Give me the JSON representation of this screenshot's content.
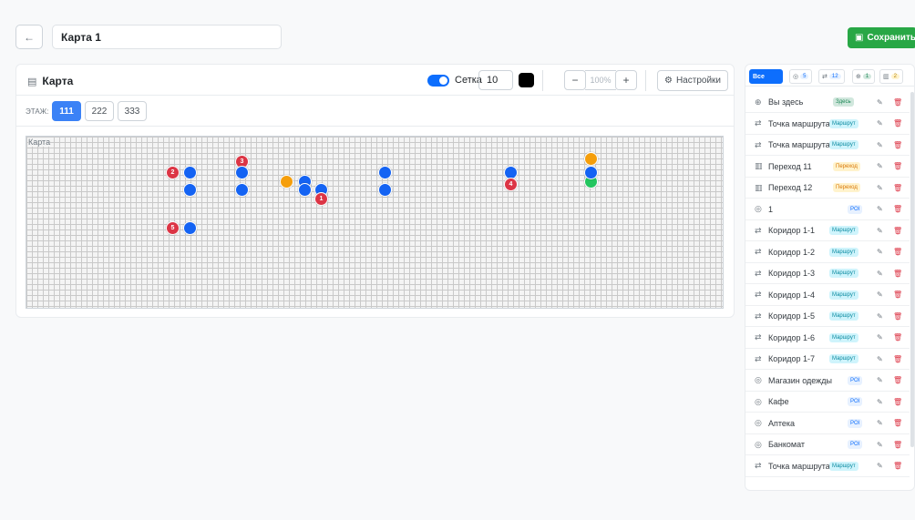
{
  "header": {
    "back_icon": "←",
    "title_value": "Карта 1",
    "save_label": "Сохранить"
  },
  "map_card": {
    "title": "Карта",
    "grid_label": "Сетка",
    "grid_size": "10",
    "zoom_minus": "−",
    "zoom_value": "100%",
    "zoom_plus": "+",
    "settings_label": "Настройки",
    "floor_label": "ЭТАЖ:",
    "floors": [
      "111",
      "222",
      "333"
    ],
    "map_alt": "Карта",
    "markers": [
      {
        "type": "red",
        "label": "2"
      },
      {
        "type": "blue",
        "label": ""
      },
      {
        "type": "blue",
        "label": ""
      },
      {
        "type": "red",
        "label": "3"
      },
      {
        "type": "blue",
        "label": ""
      },
      {
        "type": "blue",
        "label": ""
      },
      {
        "type": "orange",
        "label": ""
      },
      {
        "type": "blue",
        "label": ""
      },
      {
        "type": "blue",
        "label": ""
      },
      {
        "type": "blue",
        "label": ""
      },
      {
        "type": "red",
        "label": "1"
      },
      {
        "type": "blue",
        "label": ""
      },
      {
        "type": "blue",
        "label": ""
      },
      {
        "type": "blue",
        "label": ""
      },
      {
        "type": "red",
        "label": "4"
      },
      {
        "type": "orange",
        "label": ""
      },
      {
        "type": "green",
        "label": ""
      },
      {
        "type": "blue",
        "label": ""
      },
      {
        "type": "red",
        "label": "5"
      },
      {
        "type": "blue",
        "label": ""
      }
    ]
  },
  "panel": {
    "filters": [
      {
        "label": "Все",
        "count": "",
        "active": true
      },
      {
        "label": "◎",
        "count": "5",
        "cls": ""
      },
      {
        "label": "⇄",
        "count": "12",
        "cls": ""
      },
      {
        "label": "⊕",
        "count": "1",
        "cls": "g"
      },
      {
        "label": "▥",
        "count": "2",
        "cls": "o"
      }
    ],
    "items": [
      {
        "icon": "⊕",
        "label": "Вы здесь",
        "badge": "Здесь",
        "kind": "here"
      },
      {
        "icon": "⇄",
        "label": "Точка маршрута",
        "badge": "Маршрут",
        "kind": "route"
      },
      {
        "icon": "⇄",
        "label": "Точка маршрута",
        "badge": "Маршрут",
        "kind": "route"
      },
      {
        "icon": "▥",
        "label": "Переход 11",
        "badge": "Переход",
        "kind": "trans"
      },
      {
        "icon": "▥",
        "label": "Переход 12",
        "badge": "Переход",
        "kind": "trans"
      },
      {
        "icon": "◎",
        "label": "1",
        "badge": "POI",
        "kind": "poi"
      },
      {
        "icon": "⇄",
        "label": "Коридор 1-1",
        "badge": "Маршрут",
        "kind": "route"
      },
      {
        "icon": "⇄",
        "label": "Коридор 1-2",
        "badge": "Маршрут",
        "kind": "route"
      },
      {
        "icon": "⇄",
        "label": "Коридор 1-3",
        "badge": "Маршрут",
        "kind": "route"
      },
      {
        "icon": "⇄",
        "label": "Коридор 1-4",
        "badge": "Маршрут",
        "kind": "route"
      },
      {
        "icon": "⇄",
        "label": "Коридор 1-5",
        "badge": "Маршрут",
        "kind": "route"
      },
      {
        "icon": "⇄",
        "label": "Коридор 1-6",
        "badge": "Маршрут",
        "kind": "route"
      },
      {
        "icon": "⇄",
        "label": "Коридор 1-7",
        "badge": "Маршрут",
        "kind": "route"
      },
      {
        "icon": "◎",
        "label": "Магазин одежды",
        "badge": "POI",
        "kind": "poi"
      },
      {
        "icon": "◎",
        "label": "Кафе",
        "badge": "POI",
        "kind": "poi"
      },
      {
        "icon": "◎",
        "label": "Аптека",
        "badge": "POI",
        "kind": "poi"
      },
      {
        "icon": "◎",
        "label": "Банкомат",
        "badge": "POI",
        "kind": "poi"
      },
      {
        "icon": "⇄",
        "label": "Точка маршрута",
        "badge": "Маршрут",
        "kind": "route"
      }
    ],
    "edit_icon": "✎",
    "delete_icon": "🗑"
  },
  "colors": {
    "accent": "#0d6efd",
    "save": "#28a745",
    "danger": "#dc3545",
    "marker_blue": "#1463f3",
    "marker_orange": "#f59e0b",
    "marker_green": "#22c55e"
  }
}
